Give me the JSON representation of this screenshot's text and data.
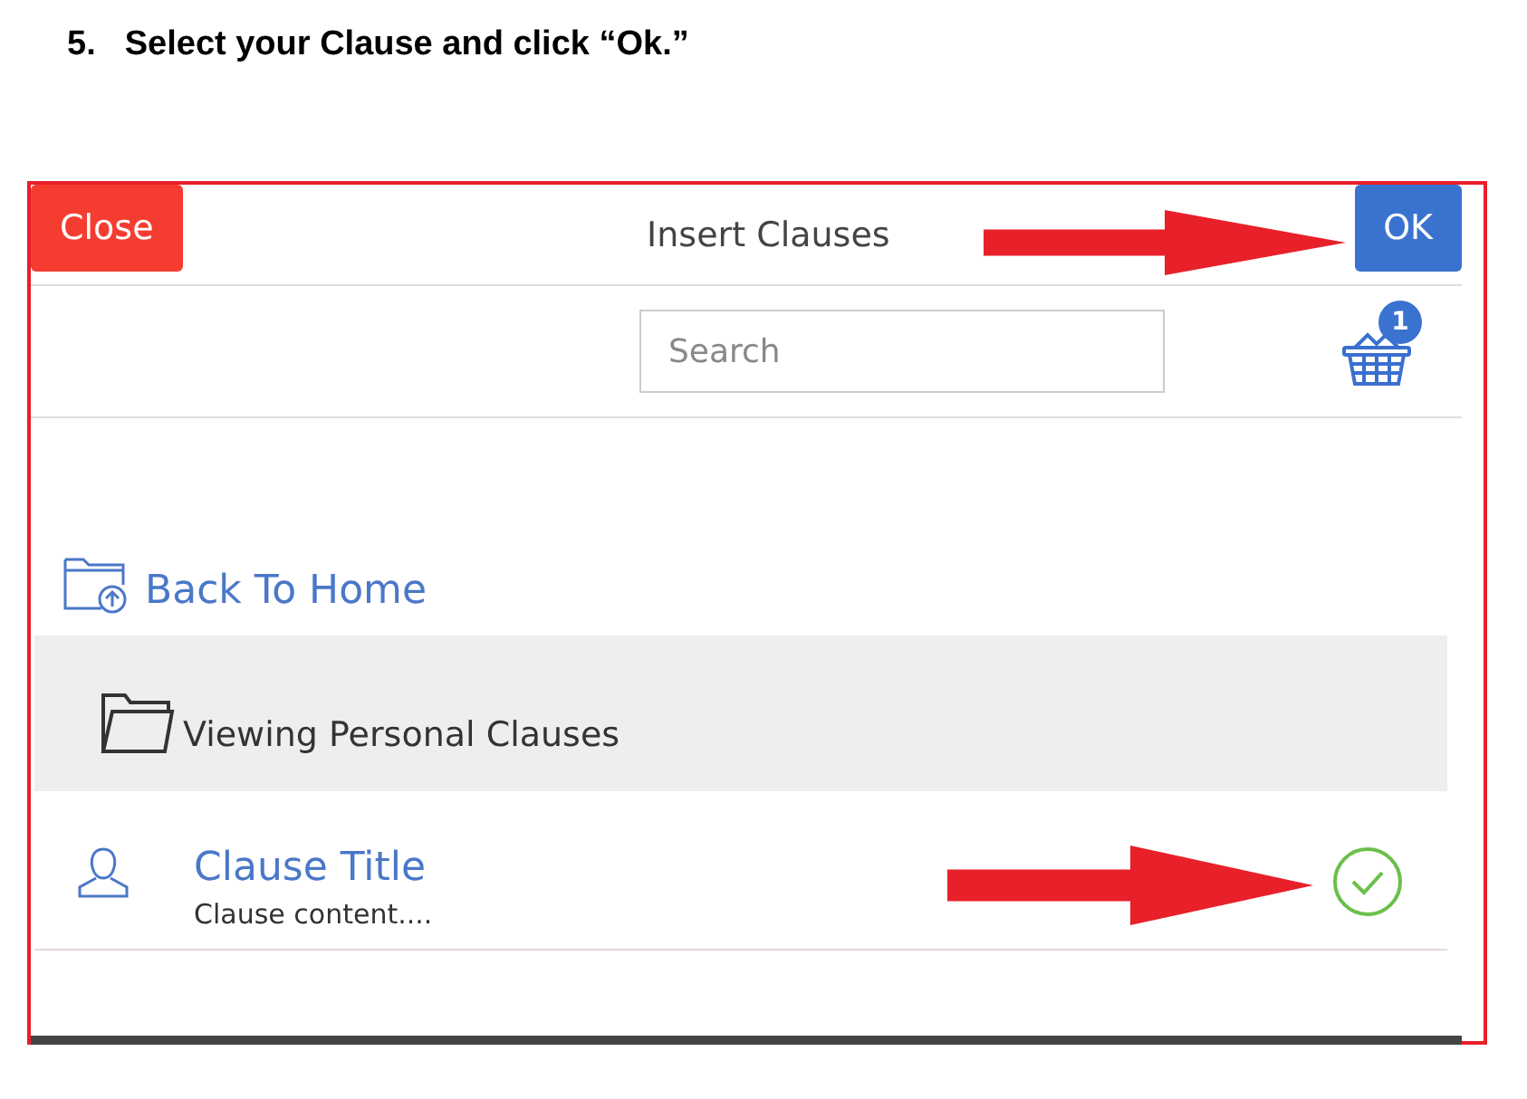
{
  "instruction": {
    "number": "5.",
    "text": "Select your Clause and click “Ok.”"
  },
  "dialog": {
    "title": "Insert Clauses",
    "close_button": "Close",
    "ok_button": "OK",
    "search": {
      "placeholder": "Search"
    },
    "basket_count": "1",
    "back_link": "Back To Home",
    "folder_label": "Viewing Personal Clauses",
    "clauses": [
      {
        "title": "Clause Title",
        "content": "Clause content....",
        "selected": true
      }
    ]
  }
}
